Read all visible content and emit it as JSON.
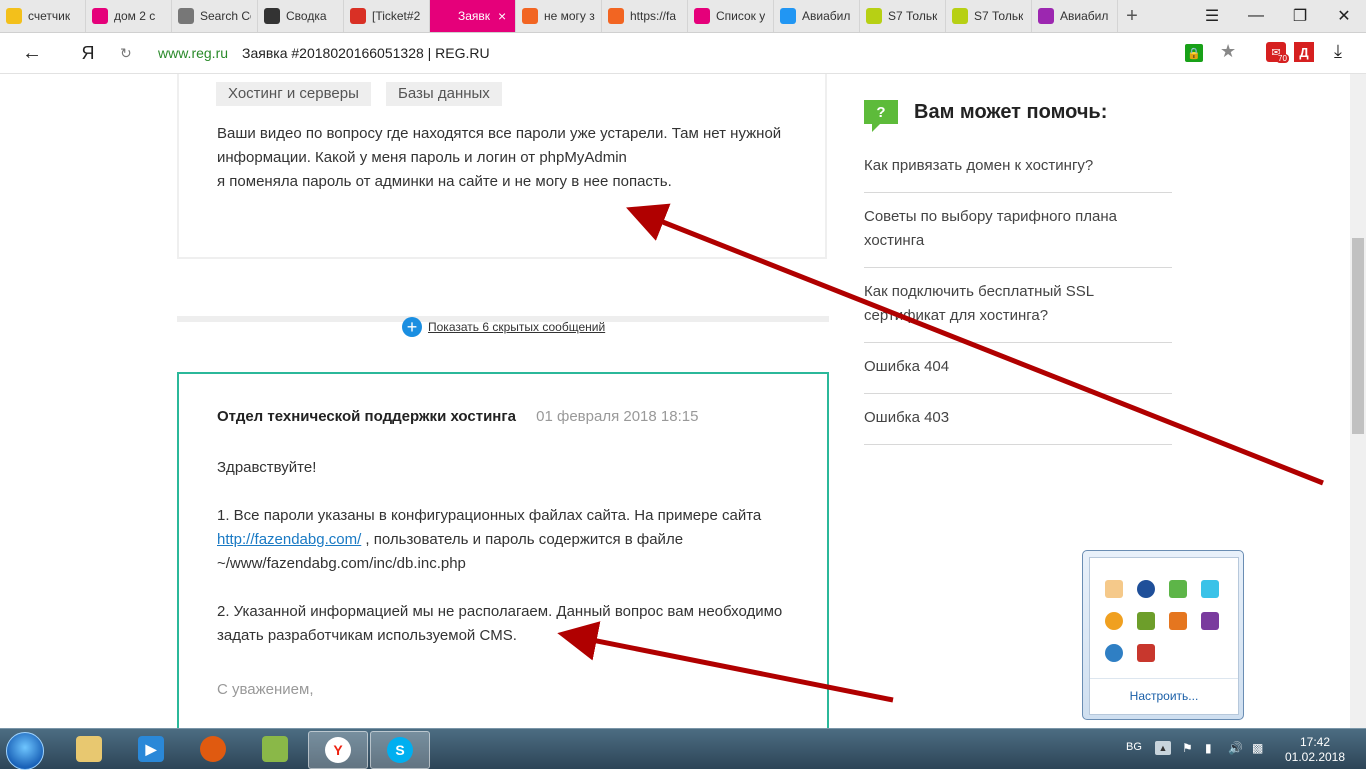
{
  "browser": {
    "tabs": [
      {
        "label": "счетчик",
        "icon": "yandex-metrica-icon",
        "color": "#f3c01b"
      },
      {
        "label": "дом 2 с",
        "icon": "number-2-icon",
        "color": "#e5007a"
      },
      {
        "label": "Search Co",
        "icon": "search-console-icon",
        "color": "#777777"
      },
      {
        "label": "Сводка",
        "icon": "code-icon",
        "color": "#333333"
      },
      {
        "label": "[Ticket#2",
        "icon": "gmail-icon",
        "color": "#d93025"
      },
      {
        "label": "Заявк",
        "icon": "reg-ru-icon",
        "color": "#e5007a",
        "active": true
      },
      {
        "label": "не могу з",
        "icon": "s-orange-icon",
        "color": "#f26522"
      },
      {
        "label": "https://fa",
        "icon": "s-orange-icon",
        "color": "#f26522"
      },
      {
        "label": "Список у",
        "icon": "reg-ru-icon",
        "color": "#e5007a"
      },
      {
        "label": "Авиабил",
        "icon": "aviasales-icon",
        "color": "#2196f3"
      },
      {
        "label": "S7 Тольк",
        "icon": "s7-icon",
        "color": "#b7d014"
      },
      {
        "label": "S7 Тольк",
        "icon": "s7-icon",
        "color": "#b7d014"
      },
      {
        "label": "Авиабил",
        "icon": "aviasales-icon",
        "color": "#9c27b0"
      }
    ],
    "new_tab_label": "+",
    "domain": "www.reg.ru",
    "page_title": "Заявка #2018020166051328 | REG.RU",
    "yandex_logo": "Я",
    "ext_badge": "70",
    "ext2_label": "Д"
  },
  "tags": [
    "Хостинг и серверы",
    "Базы данных"
  ],
  "message1": {
    "lines": [
      "Ваши видео по вопросу где находятся все пароли уже устарели. Там нет нужной",
      "информации. Какой у меня пароль и логин от  phpMyAdmin",
      "я поменяла пароль от админки на сайте и не могу в нее попасть."
    ]
  },
  "show_hidden": {
    "label": "Показать 6 скрытых сообщений"
  },
  "message2": {
    "department": "Отдел технической поддержки хостинга",
    "date": "01 февраля 2018 18:15",
    "greeting": "Здравствуйте!",
    "p1_line1": "1. Все пароли указаны в конфигурационных файлах сайта. На примере сайта",
    "p1_link": "http://fazendabg.com/",
    "p1_line2_rest": " , пользователь и пароль содержится в файле",
    "p1_line3": "~/www/fazendabg.com/inc/db.inc.php",
    "p2_line1": "2. Указанной информацией мы не располагаем. Данный вопрос вам необходимо",
    "p2_line2": "задать разработчикам используемой CMS.",
    "signature": "С уважением,"
  },
  "sidebar": {
    "icon_text": "?",
    "title": "Вам может помочь:",
    "items": [
      {
        "lines": [
          "Как привязать домен к хостингу?"
        ]
      },
      {
        "lines": [
          "Советы по выбору тарифного плана",
          "хостинга"
        ]
      },
      {
        "lines": [
          "Как подключить бесплатный SSL",
          "сертификат для хостинга?"
        ]
      },
      {
        "lines": [
          "Ошибка 404"
        ]
      },
      {
        "lines": [
          "Ошибка 403"
        ]
      }
    ]
  },
  "tray_popup": {
    "customize_label": "Настроить..."
  },
  "taskbar": {
    "language": "BG",
    "time": "17:42",
    "date": "01.02.2018"
  },
  "colors": {
    "accent_brand": "#e5007a",
    "card_border_active": "#2bb89a",
    "link": "#1a7ac4",
    "annotation_arrow": "#b00000",
    "sidebar_icon": "#5dbb3a"
  }
}
